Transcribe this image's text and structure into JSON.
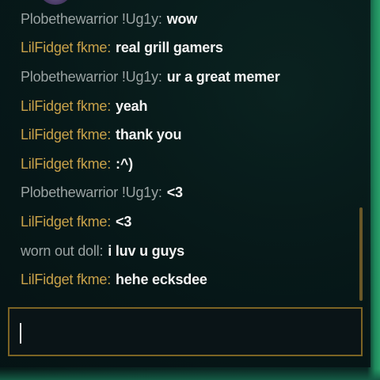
{
  "chat": {
    "messages": [
      {
        "sender": "Plobethewarrior  !Ug1y:",
        "text": "wow",
        "sender_color": "gray"
      },
      {
        "sender": "LilFidget fkme:",
        "text": "real grill gamers",
        "sender_color": "gold"
      },
      {
        "sender": "Plobethewarrior  !Ug1y:",
        "text": "ur a great memer",
        "sender_color": "gray"
      },
      {
        "sender": "LilFidget fkme:",
        "text": "yeah",
        "sender_color": "gold"
      },
      {
        "sender": "LilFidget fkme:",
        "text": "thank you",
        "sender_color": "gold"
      },
      {
        "sender": "LilFidget fkme:",
        "text": ":^)",
        "sender_color": "gold"
      },
      {
        "sender": "Plobethewarrior  !Ug1y:",
        "text": "<3",
        "sender_color": "gray"
      },
      {
        "sender": "LilFidget fkme:",
        "text": "<3",
        "sender_color": "gold"
      },
      {
        "sender": "worn out doll:",
        "text": "i luv u guys",
        "sender_color": "gray"
      },
      {
        "sender": "LilFidget fkme:",
        "text": "hehe ecksdee",
        "sender_color": "gold"
      }
    ],
    "input": {
      "value": "",
      "placeholder": ""
    }
  },
  "colors": {
    "sender_gold": "#c9a24a",
    "sender_gray": "#9aa3a3",
    "message_text": "#f2f2f2",
    "input_border": "#7c6424"
  }
}
